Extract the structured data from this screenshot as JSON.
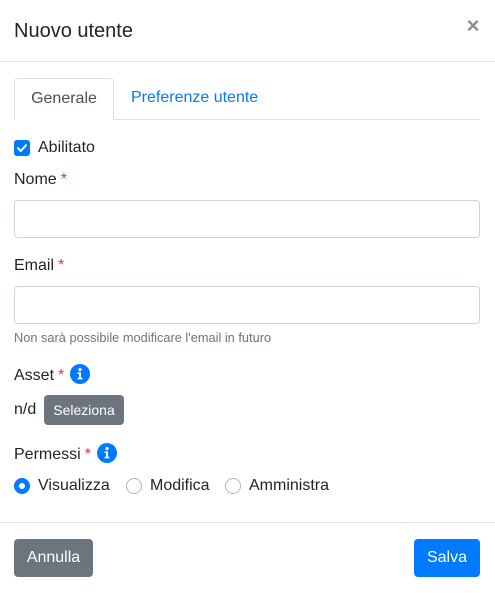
{
  "header": {
    "title": "Nuovo utente",
    "close_label": "×"
  },
  "tabs": [
    {
      "label": "Generale",
      "active": true
    },
    {
      "label": "Preferenze utente",
      "active": false
    }
  ],
  "form": {
    "enabled": {
      "label": "Abilitato",
      "checked": true
    },
    "name": {
      "label": "Nome",
      "required_mark": "*",
      "value": "",
      "placeholder": ""
    },
    "email": {
      "label": "Email",
      "required_mark": "*",
      "value": "",
      "placeholder": "",
      "help": "Non sarà possibile modificare l'email in futuro"
    },
    "asset": {
      "label": "Asset",
      "required_mark": "*",
      "value": "n/d",
      "select_label": "Seleziona"
    },
    "permissions": {
      "label": "Permessi",
      "required_mark": "*",
      "options": [
        {
          "label": "Visualizza",
          "checked": true
        },
        {
          "label": "Modifica",
          "checked": false
        },
        {
          "label": "Amministra",
          "checked": false
        }
      ]
    }
  },
  "footer": {
    "cancel_label": "Annulla",
    "save_label": "Salva"
  },
  "colors": {
    "primary": "#007bff",
    "secondary": "#6c757d",
    "danger": "#dc3545",
    "border": "#dee2e6"
  },
  "icons": {
    "close": "close-icon",
    "info": "info-icon",
    "check": "check-icon"
  }
}
